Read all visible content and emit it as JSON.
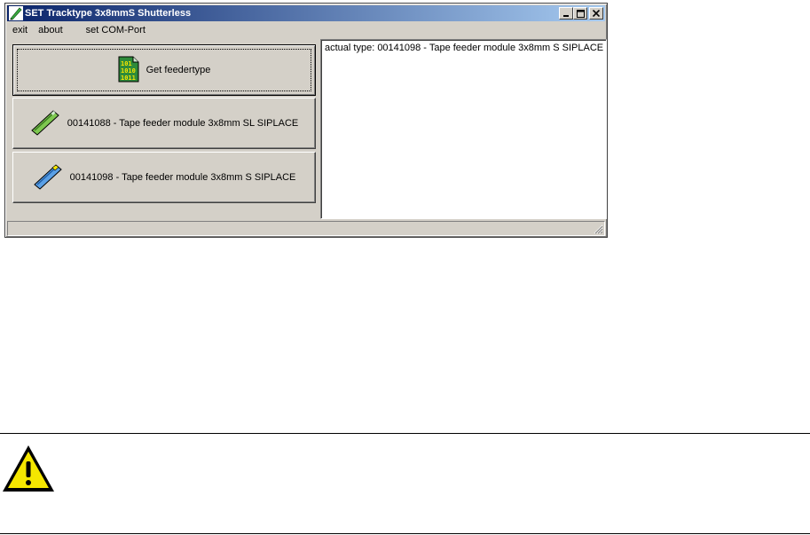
{
  "window": {
    "title": "SET Tracktype 3x8mmS Shutterless",
    "title_buttons": {
      "minimize": "_",
      "maximize": "□",
      "close": "×"
    }
  },
  "menu": {
    "items": [
      "exit",
      "about",
      "set COM-Port"
    ]
  },
  "buttons": {
    "get_feedertype": {
      "label": "Get feedertype",
      "icon": "binary-document-icon"
    },
    "feeder_sl": {
      "label": "00141088 - Tape feeder module 3x8mm SL SIPLACE",
      "icon": "green-feeder-icon"
    },
    "feeder_s": {
      "label": "00141098 - Tape feeder module 3x8mm S SIPLACE",
      "icon": "blue-feeder-icon"
    }
  },
  "output": {
    "text": "actual type: 00141098 - Tape feeder module 3x8mm S SIPLACE"
  },
  "colors": {
    "titlebar_start": "#0a246a",
    "titlebar_end": "#a6caf0",
    "window_face": "#d4d0c8",
    "warning_yellow": "#f5e600"
  },
  "document": {
    "warning_icon": "warning-triangle-icon"
  }
}
